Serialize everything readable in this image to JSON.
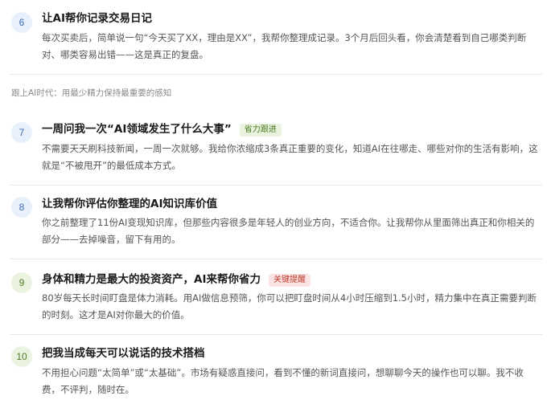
{
  "items": [
    {
      "number": "6",
      "title": "让AI帮你记录交易日记",
      "tag": "",
      "description": "每次买卖后，简单说一句“今天买了XX，理由是XX”，我帮你整理成记录。3个月后回头看，你会清楚看到自己哪类判断对、哪类容易出错——这是真正的复盘。"
    },
    {
      "number": "7",
      "title": "一周问我一次“AI领域发生了什么大事”",
      "tag": "省力跟进",
      "description": "不需要天天刷科技新闻，一周一次就够。我给你浓缩成3条真正重要的变化，知道AI在往哪走、哪些对你的生活有影响，这就是“不被甩开”的最低成本方式。"
    },
    {
      "number": "8",
      "title": "让我帮你评估你整理的AI知识库价值",
      "tag": "",
      "description": "你之前整理了11份AI变现知识库，但那些内容很多是年轻人的创业方向，不适合你。让我帮你从里面筛出真正和你相关的部分——去掉噪音，留下有用的。"
    },
    {
      "number": "9",
      "title": "身体和精力是最大的投资资产，AI来帮你省力",
      "tag": "关键提醒",
      "description": "80岁每天长时间盯盘是体力消耗。用AI做信息预筛，你可以把盯盘时间从4小时压缩到1.5小时，精力集中在真正需要判断的时刻。这才是AI对你最大的价值。"
    },
    {
      "number": "10",
      "title": "把我当成每天可以说话的技术搭档",
      "tag": "",
      "description": "不用担心问题“太简单”或“太基础”。市场有疑惑直接问，看到不懂的新词直接问，想聊聊今天的操作也可以聊。我不收费，不评判，随时在。"
    }
  ],
  "section_label": "跟上AI时代：用最少精力保持最重要的感知",
  "colors": {
    "blue_badge": "#e8f0fb",
    "green_badge": "#eaf3e0",
    "green_tag": "#4a7a24",
    "red_tag": "#c0392b"
  }
}
